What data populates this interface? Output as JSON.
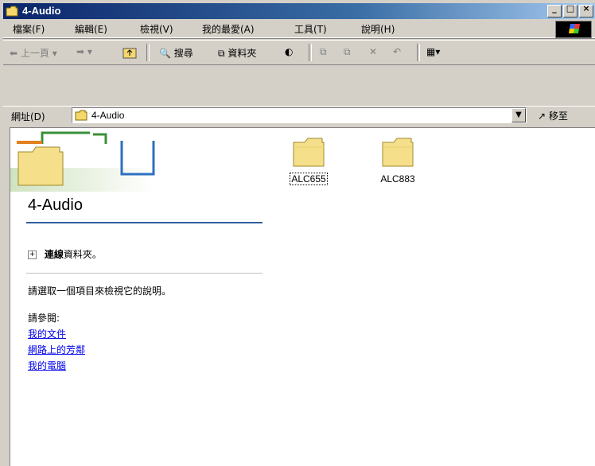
{
  "window": {
    "title": "4-Audio",
    "title_buttons": [
      "minimize",
      "maximize",
      "close"
    ]
  },
  "menubar": {
    "items": [
      "檔案(F)",
      "編輯(E)",
      "檢視(V)",
      "我的最愛(A)",
      "工具(T)",
      "說明(H)"
    ]
  },
  "toolbar": {
    "back_label": "上一頁",
    "search_label": "搜尋",
    "folders_label": "資料夾"
  },
  "address": {
    "label": "網址(D)",
    "value": "4-Audio",
    "go_label": "移至"
  },
  "left_pane": {
    "title": "4-Audio",
    "online_folder_bold": "連線",
    "online_folder_rest": "資料夾。",
    "instruction": "請選取一個項目來檢視它的說明。",
    "see_also_label": "請參閱:",
    "links": [
      "我的文件",
      "網路上的芳鄰",
      "我的電腦"
    ]
  },
  "files": [
    {
      "name": "ALC655",
      "type": "folder",
      "selected": true
    },
    {
      "name": "ALC883",
      "type": "folder",
      "selected": false
    }
  ],
  "colors": {
    "title_gradient_start": "#0a246a",
    "title_gradient_end": "#a6caf0",
    "window_face": "#d4d0c8",
    "link": "#0000ee",
    "accent_rule": "#2e5f9e"
  }
}
